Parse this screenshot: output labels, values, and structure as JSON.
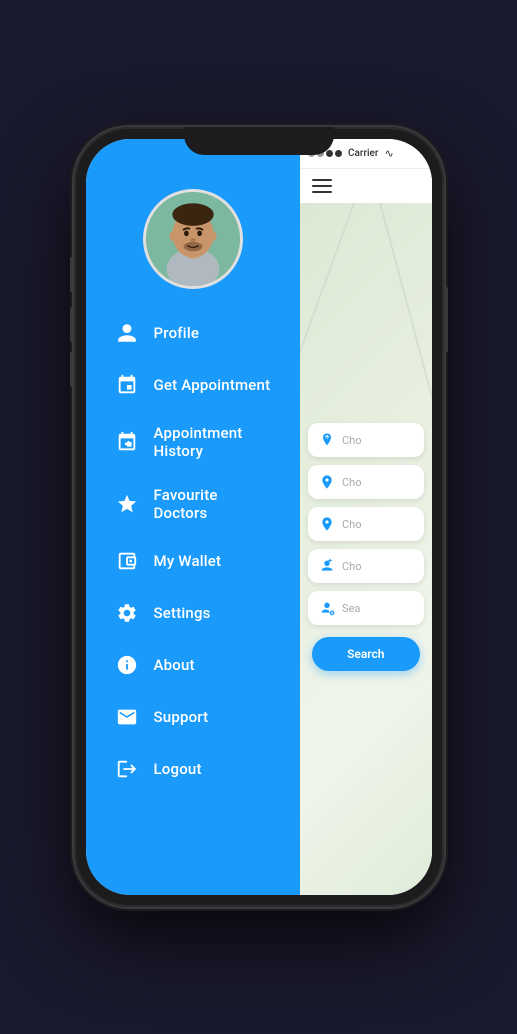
{
  "phone": {
    "status_bar": {
      "carrier": "Carrier",
      "wifi": "⌾"
    }
  },
  "sidebar": {
    "menu_items": [
      {
        "id": "profile",
        "label": "Profile",
        "icon": "person"
      },
      {
        "id": "get-appointment",
        "label": "Get Appointment",
        "icon": "calendar"
      },
      {
        "id": "appointment-history",
        "label": "Appointment History",
        "icon": "calendar-check"
      },
      {
        "id": "favourite-doctors",
        "label": "Favourite Doctors",
        "icon": "star"
      },
      {
        "id": "my-wallet",
        "label": "My Wallet",
        "icon": "wallet"
      },
      {
        "id": "settings",
        "label": "Settings",
        "icon": "gear"
      },
      {
        "id": "about",
        "label": "About",
        "icon": "info"
      },
      {
        "id": "support",
        "label": "Support",
        "icon": "mail"
      },
      {
        "id": "logout",
        "label": "Logout",
        "icon": "logout"
      }
    ]
  },
  "right_panel": {
    "carrier": "Carrier",
    "hamburger_label": "≡",
    "filter_cards": [
      {
        "id": "card-1",
        "placeholder": "Cho",
        "icon": "location-medical"
      },
      {
        "id": "card-2",
        "placeholder": "Cho",
        "icon": "location-pin"
      },
      {
        "id": "card-3",
        "placeholder": "Cho",
        "icon": "location-pin"
      },
      {
        "id": "card-4",
        "placeholder": "Cho",
        "icon": "person-medical"
      },
      {
        "id": "card-5",
        "placeholder": "Sea",
        "icon": "search-person"
      }
    ],
    "search_button": "Search"
  },
  "colors": {
    "blue": "#1a9bfc",
    "sidebar_bg": "#1a9bfc",
    "white": "#ffffff"
  }
}
